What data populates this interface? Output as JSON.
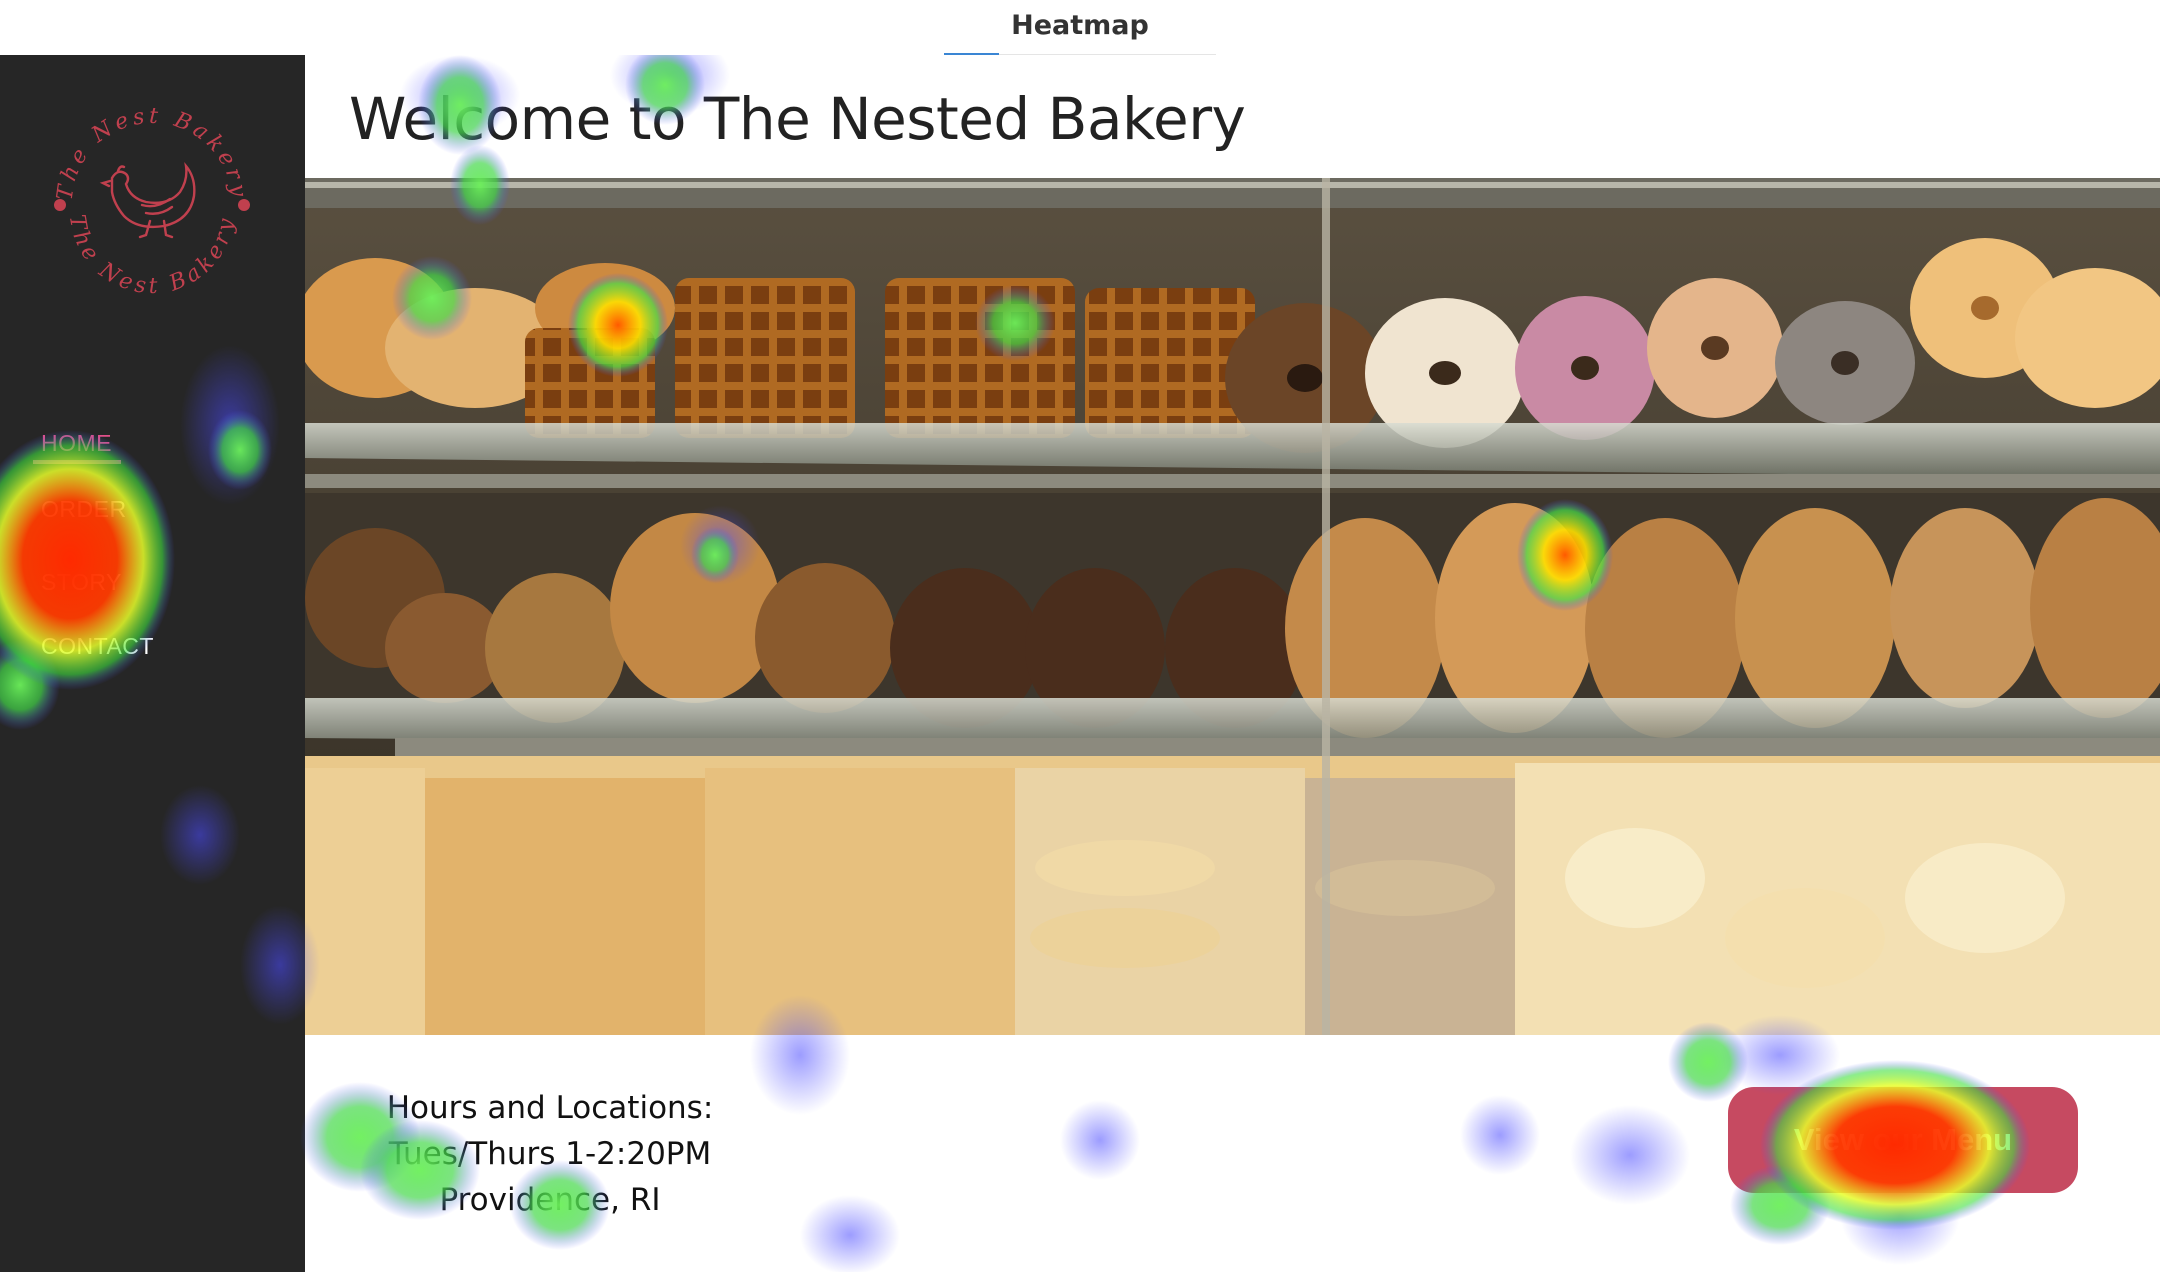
{
  "tool": {
    "title": "Heatmap"
  },
  "logo": {
    "name": "The Nest Bakery"
  },
  "nav": [
    {
      "label": "HOME",
      "active": true
    },
    {
      "label": "ORDER"
    },
    {
      "label": "STORY"
    },
    {
      "label": "CONTACT"
    }
  ],
  "main": {
    "welcome": "Welcome to The Nested Bakery",
    "hours_title": "Hours and Locations:",
    "hours_time": "Tues/Thurs 1-2:20PM",
    "hours_place": "Providence, RI",
    "menu_button": "View our Menu"
  },
  "colors": {
    "sidebar": "#262626",
    "accent_pink": "#e0508a",
    "button": "#c64a61",
    "logo_red": "#c0404e"
  },
  "icons": [
    "hen-logo-icon"
  ]
}
